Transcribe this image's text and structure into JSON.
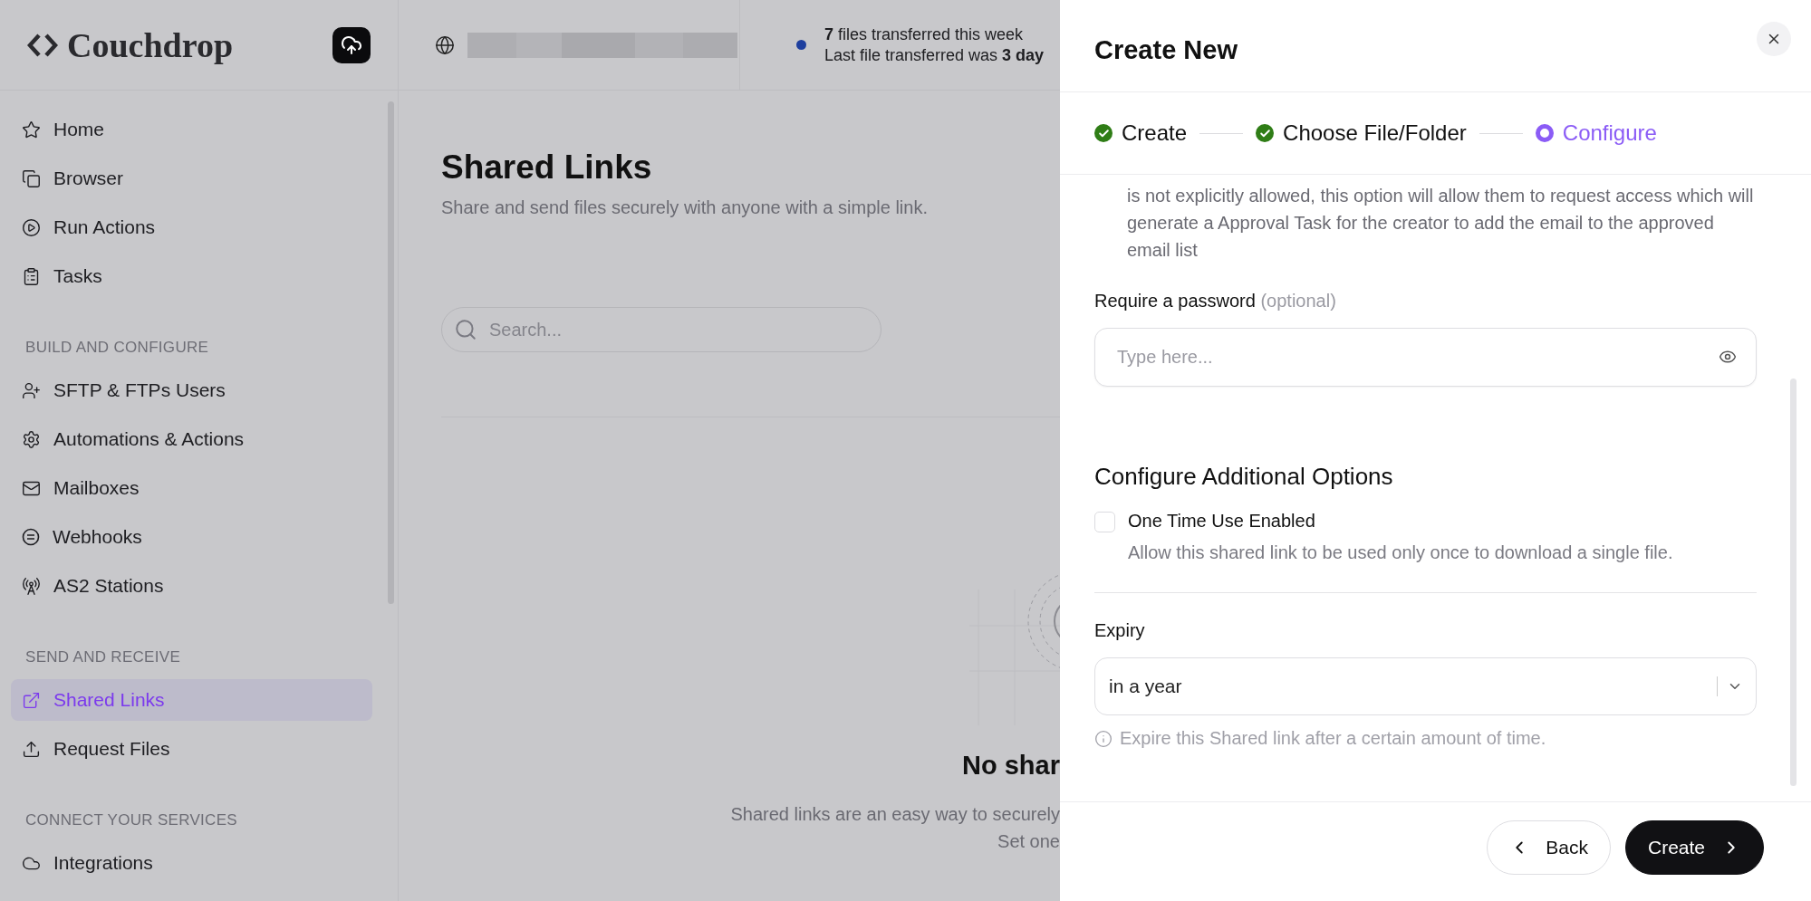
{
  "header": {
    "logo": "Couchdrop",
    "stats": [
      "**7** files transferred this week",
      "Last file transferred was **3 day**"
    ]
  },
  "sidebar": {
    "sections": [
      {
        "items": [
          {
            "label": "Home",
            "selected": false
          },
          {
            "label": "Browser",
            "selected": false
          },
          {
            "label": "Run Actions",
            "selected": false
          },
          {
            "label": "Tasks",
            "selected": false
          }
        ]
      },
      {
        "heading": "BUILD AND CONFIGURE",
        "items": [
          {
            "label": "SFTP & FTPs Users",
            "selected": false
          },
          {
            "label": "Automations & Actions",
            "selected": false
          },
          {
            "label": "Mailboxes",
            "selected": false
          },
          {
            "label": "Webhooks",
            "selected": false
          },
          {
            "label": "AS2 Stations",
            "selected": false
          }
        ]
      },
      {
        "heading": "SEND AND RECEIVE",
        "items": [
          {
            "label": "Shared Links",
            "selected": true
          },
          {
            "label": "Request Files",
            "selected": false
          }
        ]
      },
      {
        "heading": "CONNECT YOUR SERVICES",
        "items": [
          {
            "label": "Integrations",
            "selected": false
          }
        ]
      }
    ]
  },
  "main": {
    "title": "Shared Links",
    "subtitle": "Share and send files securely with anyone with a simple link.",
    "search": {
      "placeholder": "Search..."
    },
    "empty_state": {
      "title": "No shar",
      "lines": [
        "Shared links are an easy way to securely",
        "Set one"
      ]
    }
  },
  "dialog": {
    "title": "Create New",
    "steps": [
      {
        "label": "Create",
        "completed": true,
        "selected": false
      },
      {
        "label": "Choose File/Folder",
        "completed": true,
        "selected": false
      },
      {
        "label": "Configure",
        "completed": false,
        "selected": true
      }
    ],
    "intro_text": "is not explicitly allowed, this option will allow them to request access which will generate a Approval Task for the creator to add the email to the approved email list",
    "password": {
      "label": "Require a password",
      "hint": "(optional)",
      "placeholder": "Type here..."
    },
    "options_heading": "Configure Additional Options",
    "options": [
      {
        "label": "One Time Use Enabled",
        "description": "Allow this shared link to be used only once to download a single file.",
        "checked": false
      }
    ],
    "expiry": {
      "label": "Expiry",
      "value": "in a year",
      "help": "Expire this Shared link after a certain amount of time."
    },
    "buttons": [
      {
        "label": "Back",
        "kind": "secondary"
      },
      {
        "label": "Create",
        "kind": "primary"
      }
    ]
  }
}
